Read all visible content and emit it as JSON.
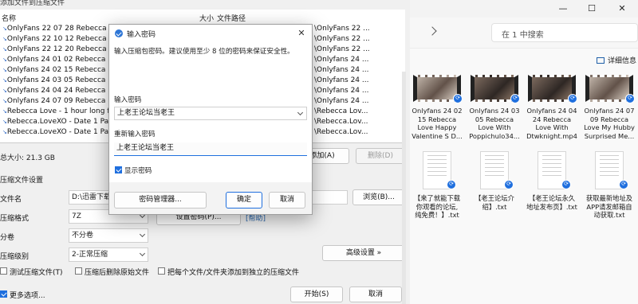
{
  "compress_dialog": {
    "title": "添加文件到压缩文件",
    "columns": {
      "name": "名称",
      "size": "大小",
      "path": "文件路径"
    },
    "files": [
      {
        "name": "OnlyFans 22 07 28 Rebecca Lov",
        "path": "\\OnlyFans 22 ..."
      },
      {
        "name": "OnlyFans 22 10 12 Rebecca Lov",
        "path": "\\OnlyFans 22 ..."
      },
      {
        "name": "OnlyFans 22 12 20 Rebecca Lov",
        "path": "\\OnlyFans 22 ..."
      },
      {
        "name": "Onlyfans 24 01 02 Rebecca Lov",
        "path": "\\Onlyfans 24 ..."
      },
      {
        "name": "Onlyfans 24 02 15 Rebecca Lov",
        "path": "\\Onlyfans 24 ..."
      },
      {
        "name": "Onlyfans 24 03 05 Rebecca Lov",
        "path": "\\Onlyfans 24 ..."
      },
      {
        "name": "Onlyfans 24 04 24 Rebecca Lov",
        "path": "\\Onlyfans 24 ..."
      },
      {
        "name": "Onlyfans 24 07 09 Rebecca Lov",
        "path": "\\Onlyfans 24 ..."
      },
      {
        "name": "Rebecca Love - 1 hour long fu",
        "path": "\\Rebecca Lov..."
      },
      {
        "name": "Rebecca.LoveXO - Date 1 Part",
        "path": "\\Rebecca.Lov..."
      },
      {
        "name": "Rebecca.LoveXO - Date 1 Part",
        "path": "\\Rebecca.Lov..."
      }
    ],
    "total": "总大小: 21.3 GB",
    "add_button": "添加(A)",
    "delete_button": "删除(D)",
    "settings_section": "压缩文件设置",
    "filename_label": "文件名",
    "filename_value": "D:\\迅雷下载",
    "browse_button": "浏览(B)...",
    "format_label": "压缩格式",
    "format_value": "7Z",
    "set_password_button": "设置密码(P)...",
    "help_link": "[帮助]",
    "split_label": "分卷",
    "split_value": "不分卷",
    "level_label": "压缩级别",
    "level_value": "2-正常压缩",
    "advanced_button": "高级设置 »",
    "test_checkbox": "测试压缩文件(T)",
    "delete_after_checkbox": "压缩后删除原始文件",
    "separate_checkbox": "把每个文件/文件夹添加到独立的压缩文件",
    "more_options": "更多选项...",
    "start_button": "开始(S)",
    "cancel_button": "取消"
  },
  "password_dialog": {
    "title": "输入密码",
    "instruction": "输入压缩包密码。建议使用至少 8 位的密码来保证安全性。",
    "enter_label": "输入密码",
    "enter_value": "上老王论坛当老王",
    "reenter_label": "重新输入密码",
    "reenter_value": "上老王论坛当老王",
    "show_password": "显示密码",
    "manager_button": "密码管理器...",
    "ok_button": "确定",
    "cancel_button": "取消"
  },
  "explorer": {
    "search_placeholder": "在 1 中搜索",
    "details_button": "详细信息",
    "window_controls": {
      "minimize": "—",
      "maximize": "☐",
      "close": "✕"
    },
    "video_tiles": [
      {
        "name": "Onlyfans 24 02\n15 Rebecca\nLove Happy\nValentine S D..."
      },
      {
        "name": "Onlyfans 24 03\n05 Rebecca\nLove With\nPoppichulo34..."
      },
      {
        "name": "Onlyfans 24 04\n24 Rebecca\nLove With\nDtwknight.mp4"
      },
      {
        "name": "Onlyfans 24 07\n09 Rebecca\nLove My Hubby\nSurprised Me..."
      }
    ],
    "text_tiles": [
      {
        "name": "【来了就能下载\n你观看的论坛,\n纯免费！】.txt"
      },
      {
        "name": "【老王论坛介\n绍】.txt"
      },
      {
        "name": "【老王论坛永久\n地址发布页】.txt"
      },
      {
        "name": "获取最新地址及\nAPP请发邮箱自\n动获取.txt"
      }
    ]
  }
}
